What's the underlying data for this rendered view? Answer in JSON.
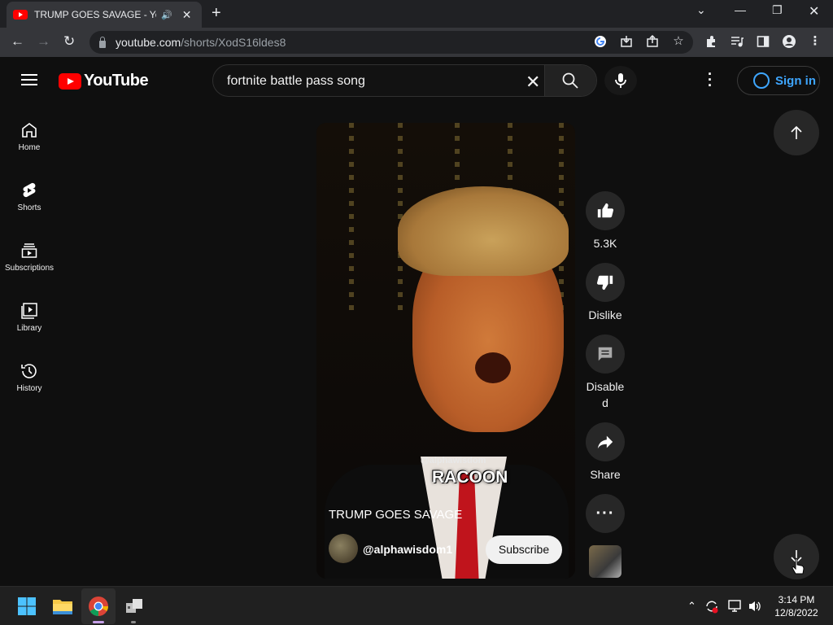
{
  "browser": {
    "tab_title": "TRUMP GOES SAVAGE - YouTube",
    "new_tab": "+",
    "url_host": "youtube.com",
    "url_path": "/shorts/XodS16ldes8"
  },
  "masthead": {
    "logo_text": "YouTube",
    "search_value": "fortnite battle pass song",
    "sign_in": "Sign in"
  },
  "sidebar": {
    "items": [
      {
        "label": "Home",
        "icon": "home-icon"
      },
      {
        "label": "Shorts",
        "icon": "shorts-icon"
      },
      {
        "label": "Subscriptions",
        "icon": "subscriptions-icon"
      },
      {
        "label": "Library",
        "icon": "library-icon"
      },
      {
        "label": "History",
        "icon": "history-icon"
      }
    ]
  },
  "short": {
    "watermark": "@alphawisdom",
    "caption": "RACOON",
    "title": "TRUMP GOES SAVAGE",
    "channel": "@alphawisdom1",
    "subscribe": "Subscribe"
  },
  "actions": {
    "like_count": "5.3K",
    "dislike": "Dislike",
    "comments": "Disabled",
    "share": "Share"
  },
  "taskbar": {
    "time": "3:14 PM",
    "date": "12/8/2022"
  }
}
